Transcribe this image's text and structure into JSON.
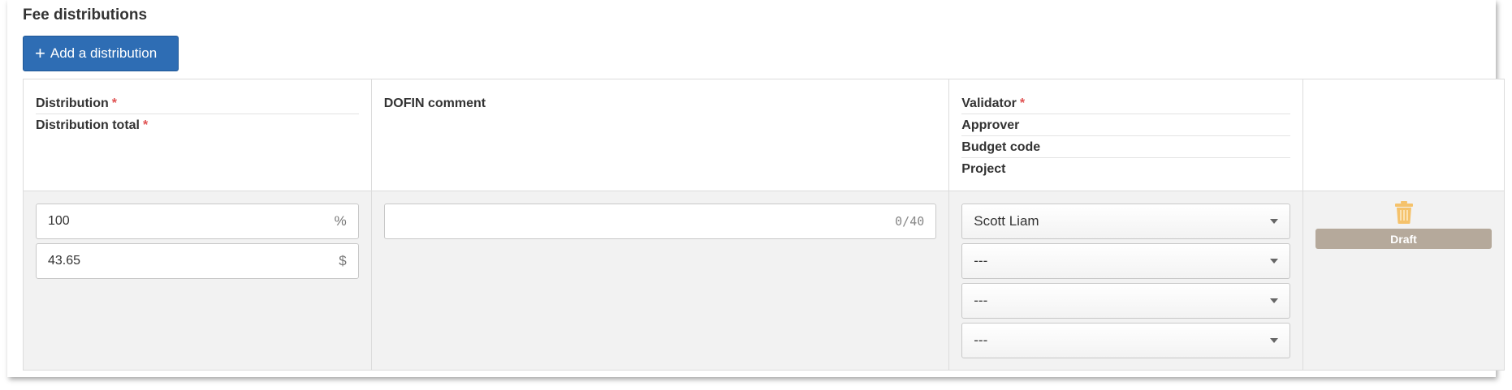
{
  "section": {
    "title": "Fee distributions"
  },
  "toolbar": {
    "add_label": "Add a distribution",
    "add_icon": "plus-icon"
  },
  "headers": {
    "distribution": "Distribution",
    "distribution_total": "Distribution total",
    "dofin_comment": "DOFIN comment",
    "validator": "Validator",
    "approver": "Approver",
    "budget_code": "Budget code",
    "project": "Project",
    "required_mark": "*"
  },
  "row": {
    "distribution_value": "100",
    "distribution_suffix": "%",
    "total_value": "43.65",
    "total_suffix": "$",
    "comment_value": "",
    "comment_counter": "0/40",
    "validator_value": "Scott Liam",
    "approver_value": "---",
    "budget_code_value": "---",
    "project_value": "---",
    "status": "Draft",
    "delete_icon": "trash-icon"
  },
  "colors": {
    "primary": "#2e6db4",
    "required": "#e05252",
    "status_badge": "#b5a99b",
    "trash": "#f5c26b"
  }
}
